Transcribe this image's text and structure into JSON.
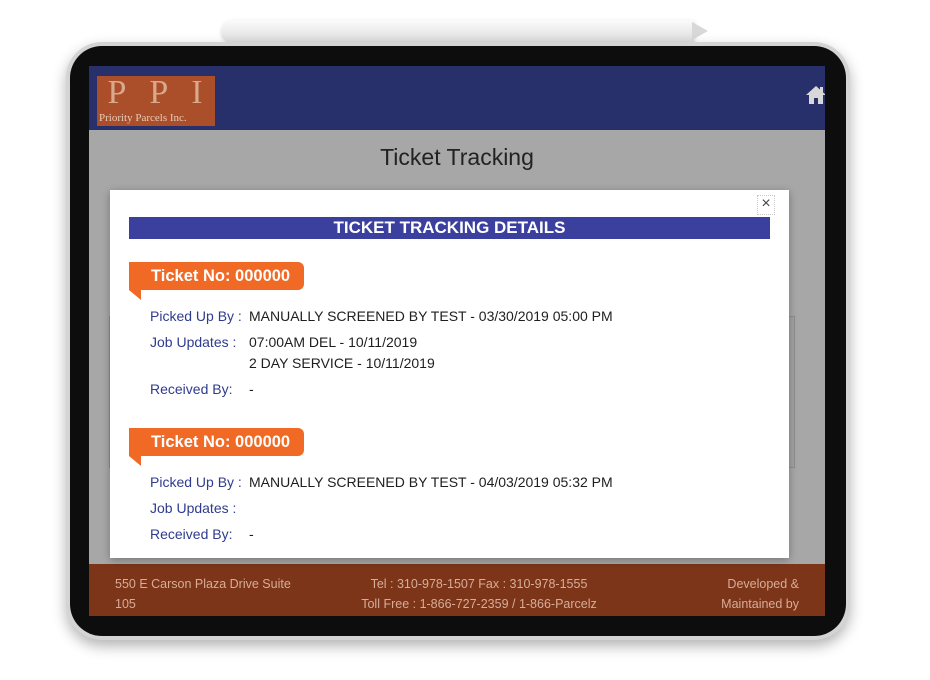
{
  "app": {
    "logo_letters": [
      "P",
      "P",
      "I"
    ],
    "logo_subtitle": "Priority Parcels Inc.",
    "page_title": "Ticket Tracking"
  },
  "modal": {
    "title": "TICKET TRACKING DETAILS",
    "close_label": "×",
    "tickets": [
      {
        "ticket_label": "Ticket No: 000000",
        "picked_up_label": "Picked Up By :",
        "picked_up_value": "MANUALLY SCREENED BY TEST - 03/30/2019 05:00 PM",
        "job_updates_label": "Job Updates :",
        "job_updates": [
          "07:00AM DEL - 10/11/2019",
          "2 DAY SERVICE - 10/11/2019"
        ],
        "received_label": "Received By:",
        "received_value": "-"
      },
      {
        "ticket_label": "Ticket No: 000000",
        "picked_up_label": "Picked Up By :",
        "picked_up_value": "MANUALLY SCREENED BY TEST - 04/03/2019 05:32 PM",
        "job_updates_label": "Job Updates :",
        "job_updates": [],
        "received_label": "Received By:",
        "received_value": "-"
      }
    ]
  },
  "footer": {
    "address_line1": "550 E Carson Plaza Drive Suite",
    "address_line2": "105",
    "phone_line1": "Tel : 310-978-1507 Fax : 310-978-1555",
    "phone_line2": "Toll Free : 1-866-727-2359 / 1-866-Parcelz",
    "credit_line1": "Developed &",
    "credit_line2": "Maintained by"
  },
  "colors": {
    "header": "#27306b",
    "logo": "#ab4f2a",
    "modal_title": "#3b3f9e",
    "ticket_tag": "#f06a26",
    "label_text": "#2f3b8f",
    "footer": "#7c3518"
  },
  "icons": [
    "home-icon",
    "close-icon"
  ]
}
